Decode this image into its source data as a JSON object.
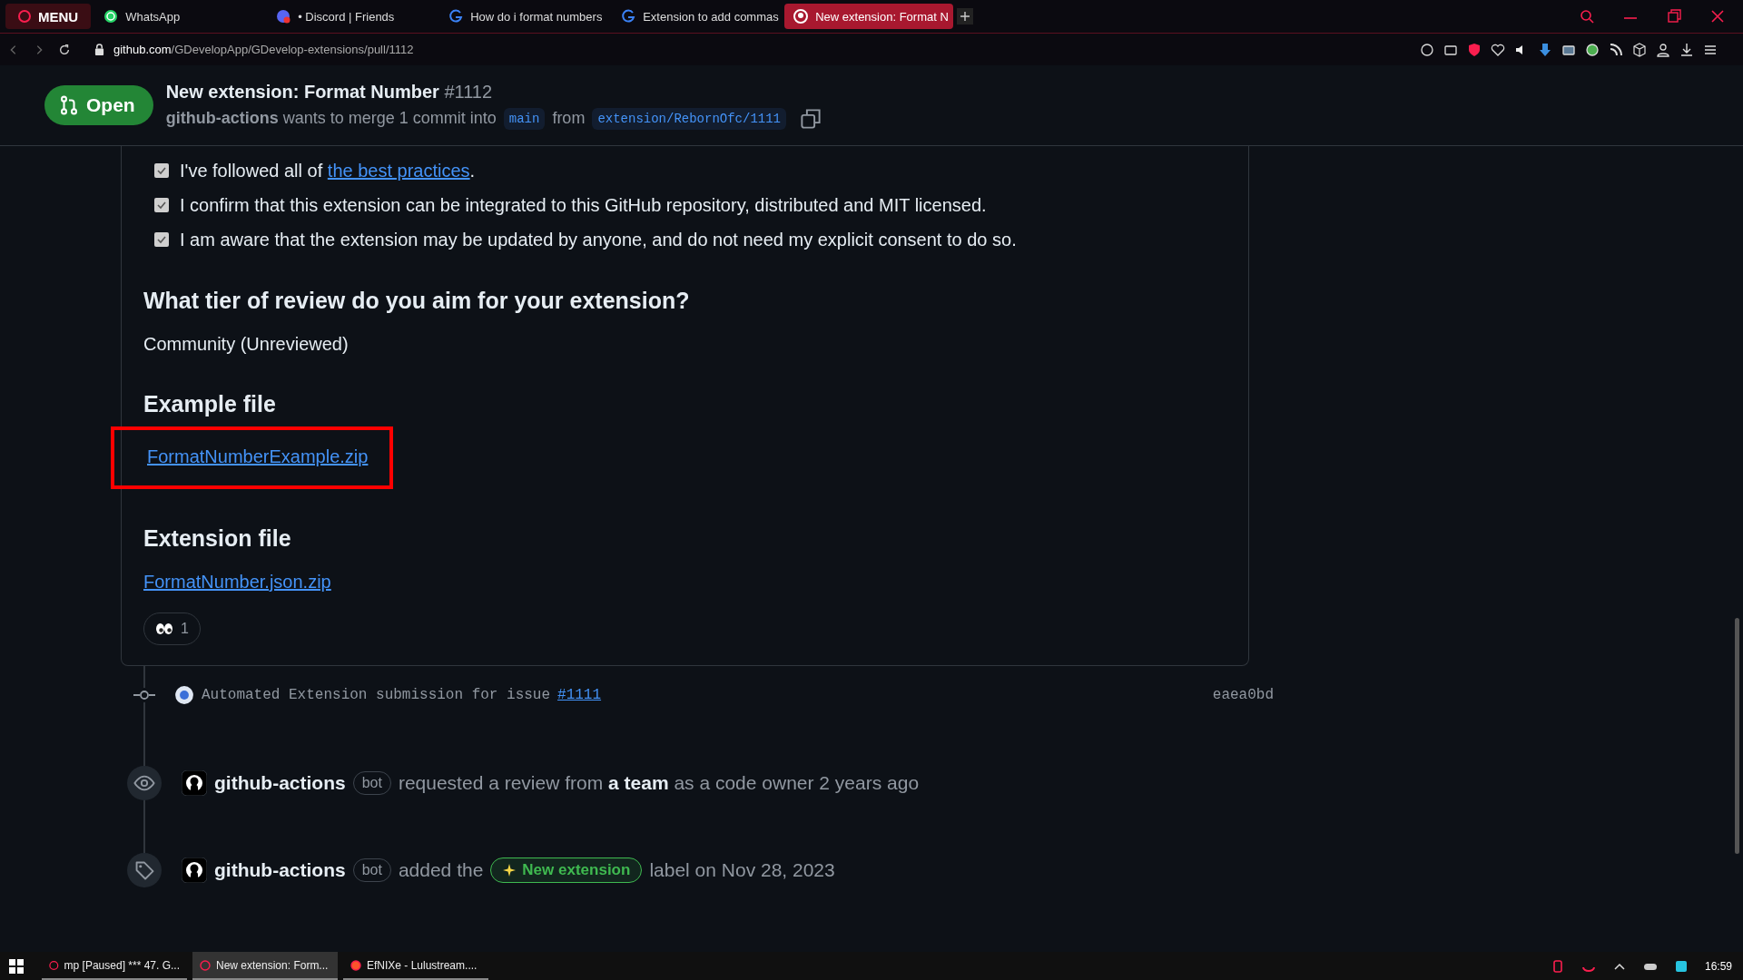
{
  "browser": {
    "menu_label": "MENU",
    "tabs": [
      {
        "label": "WhatsApp",
        "kind": "whatsapp",
        "selected": false
      },
      {
        "label": "• Discord | Friends",
        "kind": "discord",
        "selected": false
      },
      {
        "label": "How do i format numbers",
        "kind": "gdevelop",
        "selected": false
      },
      {
        "label": "Extension to add commas",
        "kind": "gdevelop",
        "selected": false
      },
      {
        "label": "New extension: Format N",
        "kind": "github",
        "selected": true
      }
    ],
    "url_host": "github.com",
    "url_path": "/GDevelopApp/GDevelop-extensions/pull/1112"
  },
  "pr": {
    "status": "Open",
    "title": "New extension: Format Number",
    "number": "#1112",
    "merge_text": "**github-actions** wants to merge 1 commit into",
    "base": "main",
    "from": "from",
    "head": "extension/RebornOfc/1111"
  },
  "checklist": [
    {
      "text": "I've followed all of",
      "link": "the best practices",
      "after": ".",
      "checked": true
    },
    {
      "text": "I confirm that this extension can be integrated to this GitHub repository, distributed and MIT licensed.",
      "checked": true
    },
    {
      "text": "I am aware that the extension may be updated by anyone, and do not need my explicit consent to do so.",
      "checked": true
    }
  ],
  "sections": [
    {
      "heading": "What tier of review do you aim for your extension?",
      "kind": "text",
      "content": "Community (Unreviewed)",
      "highlighted": false
    },
    {
      "heading": "Example file",
      "kind": "link",
      "content": "FormatNumberExample.zip",
      "highlighted": true
    },
    {
      "heading": "Extension file",
      "kind": "link",
      "content": "FormatNumber.json.zip",
      "highlighted": false
    }
  ],
  "reaction": {
    "count": "1"
  },
  "timeline": [
    {
      "kind": "commit",
      "message": "Automated Extension submission for issue",
      "issue": "#1111",
      "sha": "eaea0bd"
    },
    {
      "kind": "review",
      "actor": "github-actions",
      "badge": "bot",
      "text": "requested a review from **a team** as a code owner 2 years ago"
    },
    {
      "kind": "label",
      "actor": "github-actions",
      "badge": "bot",
      "text": "added the",
      "label": "New extension",
      "color": "#3fb950",
      "after": "label on Nov 28, 2023"
    }
  ],
  "taskbar": {
    "items": [
      {
        "label": "mp [Paused] *** 47. G...",
        "selected": false
      },
      {
        "label": "New extension: Form...",
        "selected": true
      },
      {
        "label": "EfNIXe - Lulustream....",
        "selected": false
      }
    ],
    "clock": "16:59"
  }
}
